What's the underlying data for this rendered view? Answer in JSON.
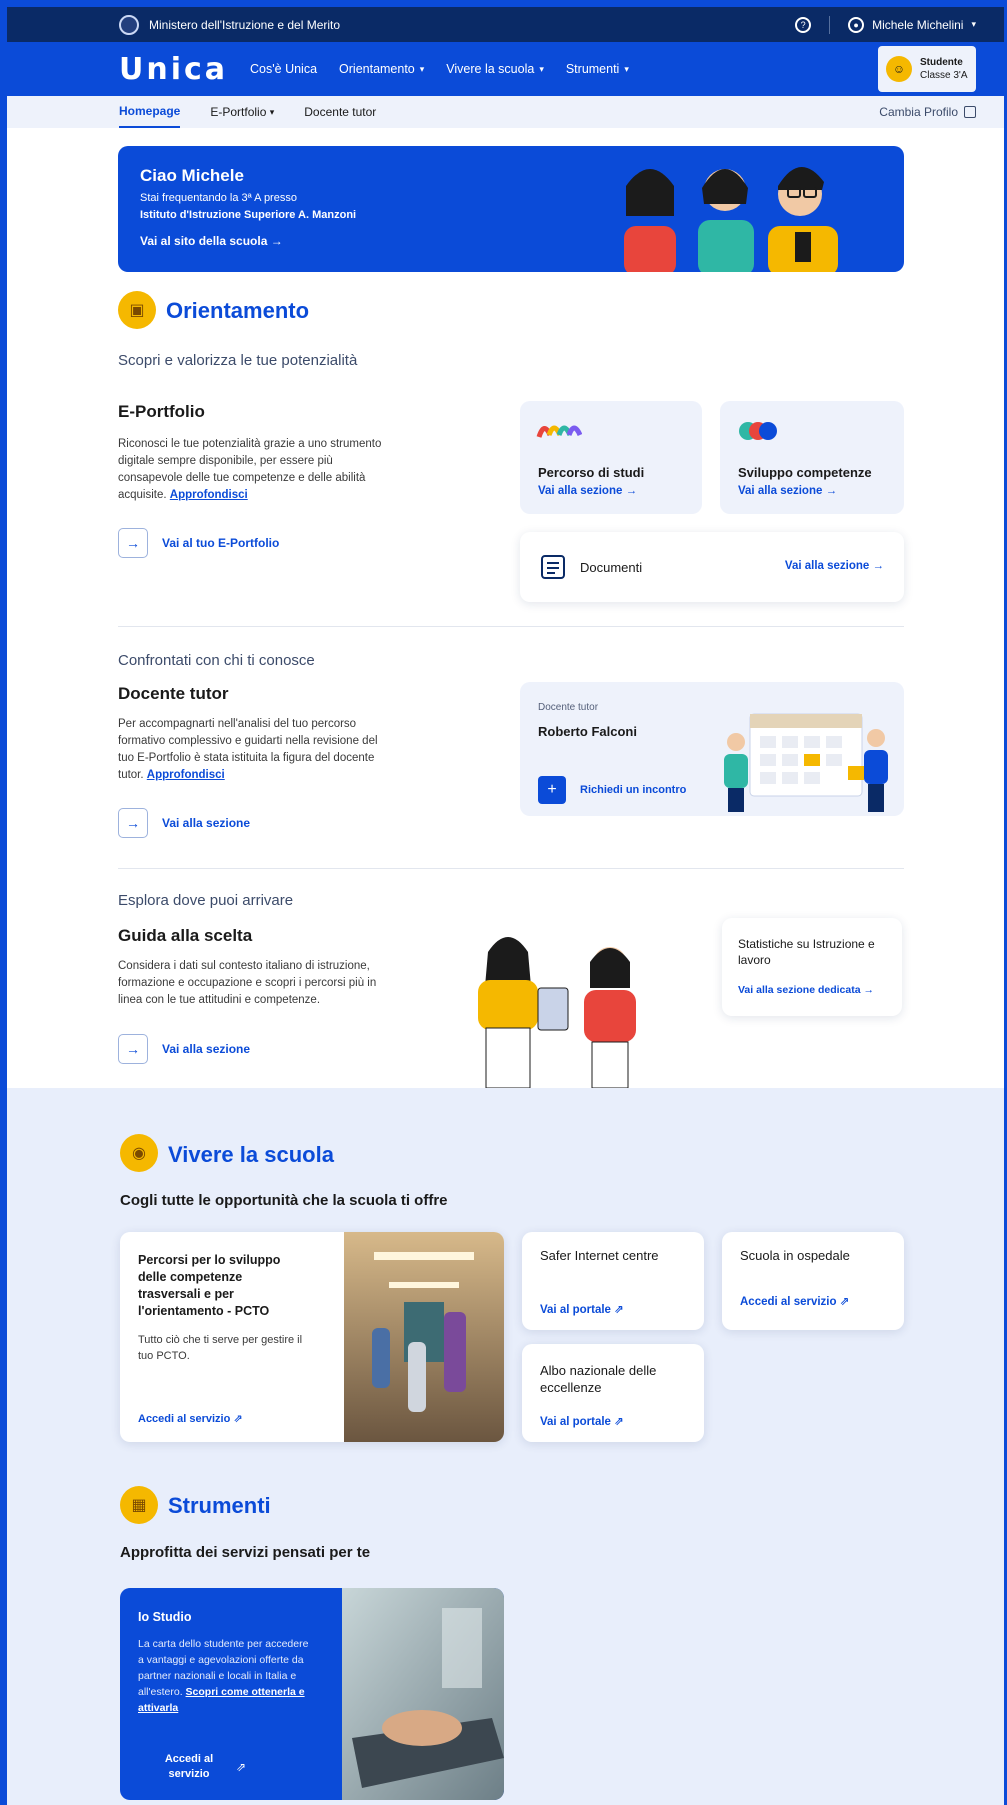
{
  "topbar": {
    "ministry": "Ministero dell'Istruzione e del Merito",
    "user": "Michele Michelini"
  },
  "nav": {
    "logo": "Unica",
    "links": [
      "Cos'è Unica",
      "Orientamento",
      "Vivere la scuola",
      "Strumenti"
    ],
    "profile_role": "Studente",
    "profile_class": "Classe 3'A"
  },
  "subnav": {
    "tabs": [
      "Homepage",
      "E-Portfolio",
      "Docente tutor"
    ],
    "switch_profile": "Cambia Profilo"
  },
  "hero": {
    "greeting": "Ciao Michele",
    "line1": "Stai frequentando la 3ª A presso",
    "line2": "Istituto d'Istruzione Superiore A. Manzoni",
    "link": "Vai al sito della scuola  →"
  },
  "orientamento": {
    "title": "Orientamento",
    "subtitle": "Scopri e valorizza le tue potenzialità",
    "eportfolio": {
      "title": "E-Portfolio",
      "text": "Riconosci le tue potenzialità grazie a uno strumento digitale sempre disponibile, per essere più consapevole delle tue competenze e delle abilità acquisite.",
      "link": "Approfondisci",
      "button": "Vai al tuo E-Portfolio"
    },
    "cards": {
      "percorso": {
        "title": "Percorso di studi",
        "link": "Vai alla sezione  →"
      },
      "sviluppo": {
        "title": "Sviluppo competenze",
        "link": "Vai alla sezione  →"
      },
      "documenti": {
        "title": "Documenti",
        "link": "Vai alla sezione  →"
      }
    },
    "confronto": {
      "subtitle": "Confrontati con chi ti conosce",
      "title": "Docente tutor",
      "text": "Per accompagnarti nell'analisi del tuo percorso formativo complessivo e guidarti nella revisione del tuo E-Portfolio è stata istituita la figura del docente tutor.",
      "link": "Approfondisci",
      "button": "Vai alla sezione",
      "tutor_label": "Docente tutor",
      "tutor_name": "Roberto Falconi",
      "tutor_action": "Richiedi un incontro"
    },
    "esplora": {
      "subtitle": "Esplora dove puoi arrivare",
      "title": "Guida alla scelta",
      "text": "Considera i dati sul contesto italiano di istruzione, formazione e occupazione e scopri i percorsi più in linea con le tue attitudini e competenze.",
      "button": "Vai alla sezione",
      "stat_title": "Statistiche su Istruzione e lavoro",
      "stat_link": "Vai alla sezione dedicata  →"
    }
  },
  "vivere": {
    "title": "Vivere la scuola",
    "subtitle": "Cogli tutte le opportunità che la scuola ti offre",
    "pcto": {
      "title": "Percorsi per lo sviluppo delle competenze trasversali e per l'orientamento - PCTO",
      "text": "Tutto ciò che ti serve per gestire il tuo PCTO.",
      "link": "Accedi al servizio  ⇗"
    },
    "safer": {
      "title": "Safer Internet centre",
      "link": "Vai al portale  ⇗"
    },
    "ospedale": {
      "title": "Scuola in ospedale",
      "link": "Accedi al servizio  ⇗"
    },
    "albo": {
      "title": "Albo nazionale delle eccellenze",
      "link": "Vai al portale  ⇗"
    }
  },
  "strumenti": {
    "title": "Strumenti",
    "subtitle": "Approfitta dei servizi pensati per te",
    "iostudio": {
      "title": "Io Studio",
      "text": "La carta dello studente per accedere a vantaggi e agevolazioni offerte da partner nazionali e locali in Italia e all'estero.",
      "link": "Scopri come ottenerla e attivarla",
      "button": "Accedi al servizio"
    }
  },
  "colors": {
    "primary": "#0b4bd8",
    "navy": "#0a2a66",
    "accent": "#f5b800",
    "tint": "#eef2fb"
  }
}
